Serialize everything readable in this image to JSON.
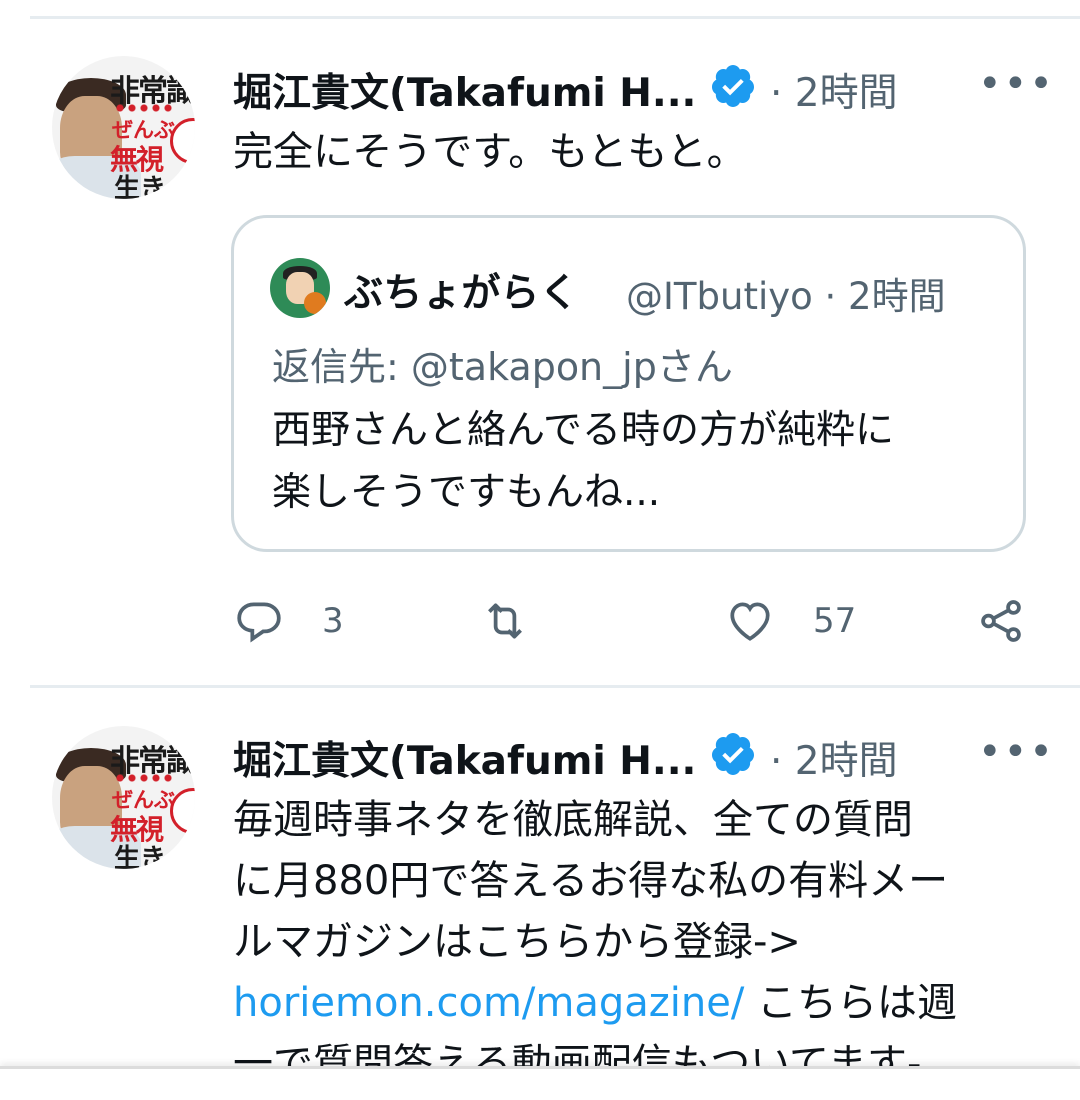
{
  "tweets": [
    {
      "author_name": "堀江貴文(Takafumi H...",
      "time": "· 2時間",
      "more": "•••",
      "text_lines": [
        "完全にそうです。もともと。"
      ],
      "quote": {
        "author_name": "ぶちょがらく",
        "handle_time": "@ITbutiyo · 2時間",
        "reply_to": "返信先: @takapon_jpさん",
        "text_lines": [
          "西野さんと絡んでる時の方が純粋に",
          "楽しそうですもんね..."
        ]
      },
      "actions": {
        "reply_count": "3",
        "like_count": "57"
      },
      "avatar_text": {
        "line1": "非常識",
        "line2": "ぜんぶ",
        "line3": "無視",
        "line4": "生き"
      }
    },
    {
      "author_name": "堀江貴文(Takafumi H...",
      "time": "· 2時間",
      "more": "•••",
      "text_lines": [
        "毎週時事ネタを徹底解説、全ての質問",
        "に月880円で答えるお得な私の有料メー",
        "ルマガジンはこちらから登録->"
      ],
      "link": "horiemon.com/magazine/",
      "after_link": " こちらは週",
      "last_line": "一で質問答える動画配信もついてます-",
      "avatar_text": {
        "line1": "非常識",
        "line2": "ぜんぶ",
        "line3": "無視",
        "line4": "生き"
      }
    }
  ],
  "icons": {
    "verified": "verified-badge-icon",
    "reply": "reply-icon",
    "retweet": "retweet-icon",
    "like": "heart-icon",
    "share": "share-icon",
    "more": "more-icon"
  },
  "colors": {
    "verified_blue": "#1d9bf0",
    "link_blue": "#1d9bf0",
    "muted": "#536471"
  }
}
